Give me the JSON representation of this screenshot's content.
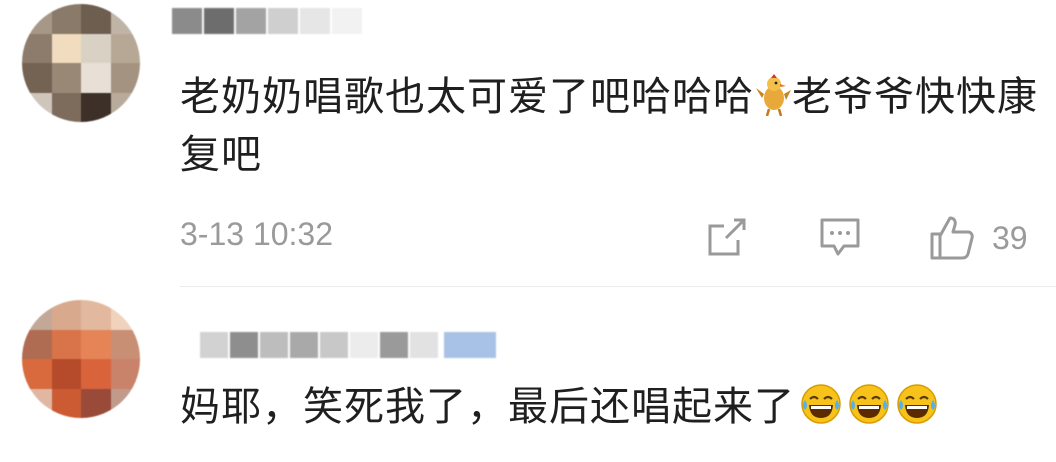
{
  "comments": [
    {
      "username": "",
      "text_before_emoji": "老奶奶唱歌也太可爱了吧哈哈哈",
      "inline_emoji": "chicken-emoji",
      "text_after_emoji": "老爷爷快快康复吧",
      "timestamp": "3-13 10:32",
      "likes": "39"
    },
    {
      "username": "",
      "text": "妈耶，笑死我了，最后还唱起来了",
      "trailing_emojis": [
        "laughing-tears-emoji",
        "laughing-tears-emoji",
        "laughing-tears-emoji"
      ]
    }
  ],
  "colors": {
    "text": "#1f1f1f",
    "meta": "#9a9a9a",
    "divider": "#ececec",
    "emoji_yellow": "#f7c21a"
  }
}
